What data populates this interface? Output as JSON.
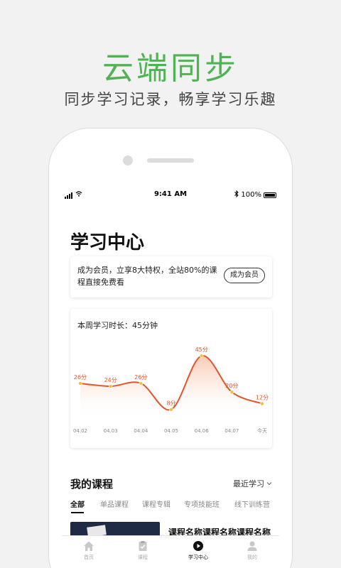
{
  "promo": {
    "title": "云端同步",
    "subtitle": "同步学习记录，畅享学习乐趣"
  },
  "status_bar": {
    "time": "9:41 AM",
    "battery": "100%"
  },
  "page": {
    "title": "学习中心"
  },
  "member": {
    "text": "成为会员，立享8大特权，全站80%的课程直接免费看",
    "button": "成为会员"
  },
  "weekly": {
    "label": "本周学习时长：45分钟"
  },
  "chart_data": {
    "type": "area",
    "title": "本周学习时长：45分钟",
    "categories": [
      "04.02",
      "04.03",
      "04.04",
      "04.05",
      "04.06",
      "04.07",
      "今天"
    ],
    "values": [
      26,
      24,
      26,
      8,
      45,
      20,
      12
    ],
    "labels": [
      "26分",
      "24分",
      "26分",
      "8分",
      "45分",
      "20分",
      "12分"
    ],
    "ylim": [
      0,
      50
    ],
    "grid": false,
    "line_color": "#e0552a",
    "point_color": "#f0c040",
    "label_color": "#e0552a"
  },
  "courses": {
    "title": "我的课程",
    "sort_label": "最近学习",
    "tabs": [
      "全部",
      "单品课程",
      "课程专辑",
      "专项技能班",
      "线下训练营"
    ],
    "first_course_title": "课程名称课程名称课程名称"
  },
  "tabbar": {
    "items": [
      {
        "label": "首页",
        "icon": "home-icon"
      },
      {
        "label": "课程",
        "icon": "clipboard-icon"
      },
      {
        "label": "学习中心",
        "icon": "play-icon"
      },
      {
        "label": "我的",
        "icon": "user-icon"
      }
    ]
  },
  "colors": {
    "brand_green": "#4fb353",
    "accent": "#e0552a"
  }
}
